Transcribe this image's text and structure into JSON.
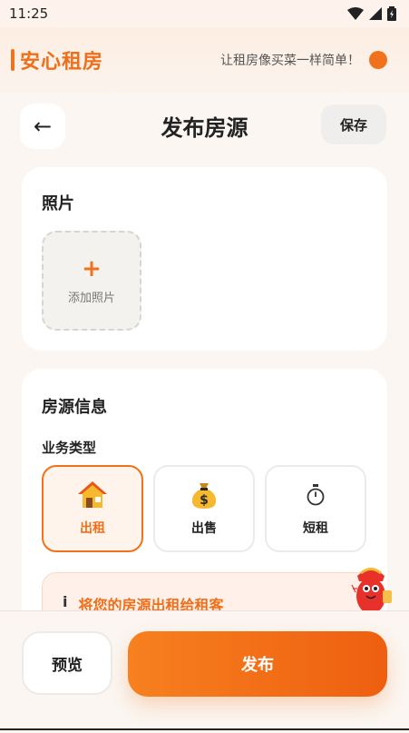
{
  "status_bar": {
    "time": "11:25"
  },
  "app": {
    "brand": "安心租房",
    "slogan": "让租房像买菜一样简单！"
  },
  "nav": {
    "back_glyph": "←",
    "title": "发布房源",
    "save_label": "保存"
  },
  "photos": {
    "title": "照片",
    "plus_glyph": "+",
    "add_label": "添加照片"
  },
  "listing_info": {
    "title": "房源信息",
    "business_type_label": "业务类型",
    "types": [
      {
        "label": "出租",
        "icon": "house-icon",
        "selected": true
      },
      {
        "label": "出售",
        "icon": "money-bag-icon",
        "selected": false
      },
      {
        "label": "短租",
        "icon": "stopwatch-icon",
        "selected": false
      }
    ],
    "tip_icon": "i",
    "tip_text": "将您的房源出租给租客"
  },
  "bottom": {
    "preview_label": "预览",
    "publish_label": "发布"
  },
  "colors": {
    "accent": "#f0721c",
    "accent_dark": "#ee5f10",
    "background": "#fbf6f1"
  }
}
